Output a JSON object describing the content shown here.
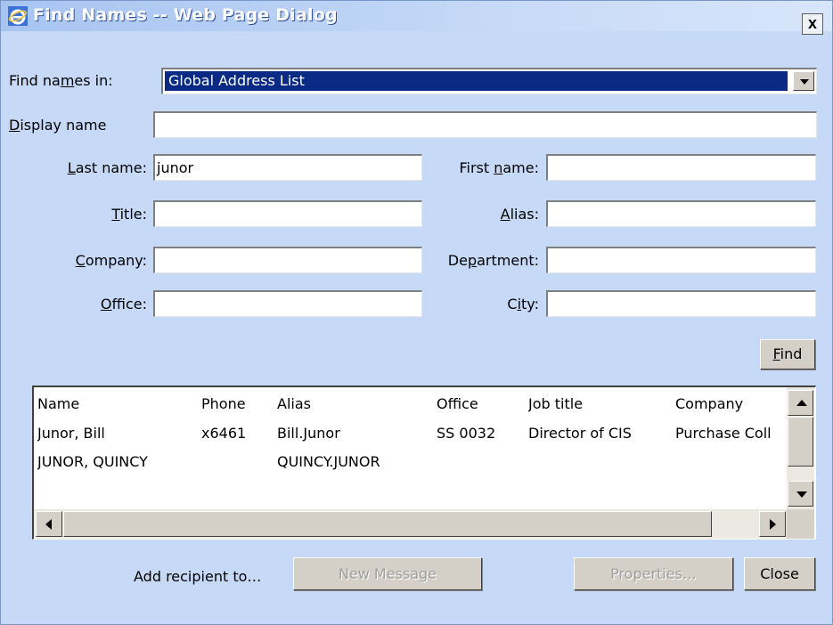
{
  "window": {
    "title": "Find Names -- Web Page Dialog",
    "close_glyph": "x"
  },
  "find_in": {
    "label_pre": "Find na",
    "label_acc": "m",
    "label_post": "es in:",
    "value": "Global Address List"
  },
  "fields": {
    "display_name": {
      "label_acc": "D",
      "label_post": "isplay name",
      "value": ""
    },
    "last_name": {
      "label_acc": "L",
      "label_post": "ast name:",
      "value": "junor"
    },
    "first_name": {
      "label_pre": "First ",
      "label_acc": "n",
      "label_post": "ame:",
      "value": ""
    },
    "title": {
      "label_acc": "T",
      "label_post": "itle:",
      "value": ""
    },
    "alias": {
      "label_acc": "A",
      "label_post": "lias:",
      "value": ""
    },
    "company": {
      "label_acc": "C",
      "label_post": "ompany:",
      "value": ""
    },
    "department": {
      "label_pre": "De",
      "label_acc": "p",
      "label_post": "artment:",
      "value": ""
    },
    "office": {
      "label_acc": "O",
      "label_post": "ffice:",
      "value": ""
    },
    "city": {
      "label_pre": "C",
      "label_acc": "i",
      "label_post": "ty:",
      "value": ""
    }
  },
  "find_button": {
    "label_acc": "F",
    "label_post": "ind"
  },
  "results": {
    "columns": [
      "Name",
      "Phone",
      "Alias",
      "Office",
      "Job title",
      "Company"
    ],
    "rows": [
      [
        "Junor, Bill",
        "x6461",
        "Bill.Junor",
        "SS 0032",
        "Director of CIS",
        "Purchase Coll"
      ],
      [
        "JUNOR, QUINCY",
        "",
        "QUINCY.JUNOR",
        "",
        "",
        ""
      ]
    ]
  },
  "footer": {
    "add_recipient_label": "Add recipient to…",
    "new_message": "New Message",
    "properties": "Properties…",
    "close": "Close"
  },
  "colors": {
    "dialog_bg": "#c6d9f7",
    "selection": "#0a2a86",
    "title_text": "#ffffff"
  },
  "icons": [
    "ie-icon",
    "close-icon",
    "dropdown-arrow-icon",
    "scroll-up-icon",
    "scroll-down-icon",
    "scroll-left-icon",
    "scroll-right-icon"
  ]
}
